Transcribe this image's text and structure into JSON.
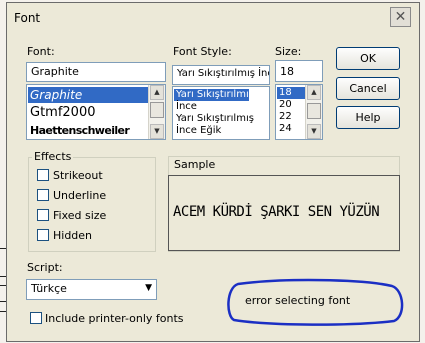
{
  "dialog": {
    "title": "Font",
    "close_glyph": "✕",
    "font_label": "Font:",
    "font_value": "Graphite",
    "font_list": [
      "Graphite",
      "Gtmf2000",
      "Haettenschweiler"
    ],
    "style_label": "Font Style:",
    "style_value": "Yarı Sıkıştırılmış İnc",
    "style_list": [
      "Yarı Sıkıştırılmış",
      "İnce",
      "Yarı Sıkıştırılmış",
      "İnce Eğik"
    ],
    "size_label": "Size:",
    "size_value": "18",
    "size_list": [
      "18",
      "20",
      "22",
      "24"
    ],
    "ok": "OK",
    "cancel": "Cancel",
    "help": "Help",
    "effects_label": "Effects",
    "strikeout": "Strikeout",
    "underline": "Underline",
    "fixed_size": "Fixed size",
    "hidden": "Hidden",
    "sample_label": "Sample",
    "sample_text": "ACEM KÜRDİ ŞARKI SEN YÜZÜN",
    "script_label": "Script:",
    "script_value": "Türkçe",
    "printer_only": "Include printer-only fonts",
    "annotation": "error selecting font"
  },
  "colors": {
    "selection": "#316ac5",
    "annotation_ink": "#1b2fc4"
  }
}
